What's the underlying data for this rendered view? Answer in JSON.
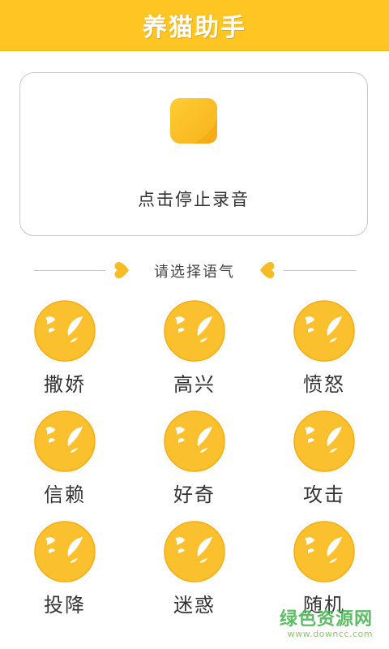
{
  "header": {
    "title": "养猫助手"
  },
  "record": {
    "stop_label": "点击停止录音",
    "button_icon": "stop-icon"
  },
  "mood_section": {
    "title": "请选择语气"
  },
  "moods": [
    {
      "label": "撒娇"
    },
    {
      "label": "高兴"
    },
    {
      "label": "愤怒"
    },
    {
      "label": "信赖"
    },
    {
      "label": "好奇"
    },
    {
      "label": "攻击"
    },
    {
      "label": "投降"
    },
    {
      "label": "迷惑"
    },
    {
      "label": "随机"
    }
  ],
  "watermark": {
    "main": "绿色资源网",
    "sub": "www.downcc.com"
  },
  "colors": {
    "accent": "#FFC523",
    "face": "#FBC02D",
    "text": "#333333",
    "divider": "#F2C94A"
  }
}
